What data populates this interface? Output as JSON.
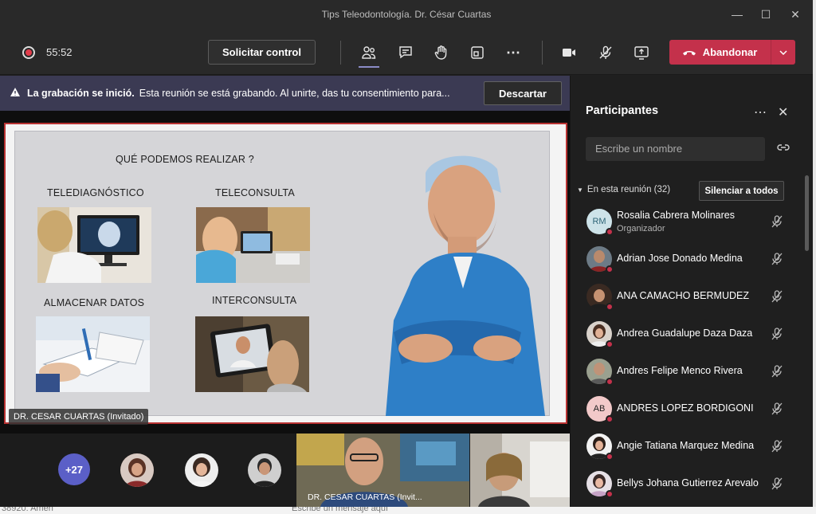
{
  "window": {
    "title": "Tips Teleodontología. Dr. César Cuartas"
  },
  "toolbar": {
    "timer": "55:52",
    "request_control_label": "Solicitar control",
    "leave_label": "Abandonar"
  },
  "banner": {
    "bold": "La grabación se inició.",
    "text": "Esta reunión se está grabando. Al unirte, das tu consentimiento para...",
    "dismiss_label": "Descartar"
  },
  "slide": {
    "heading": "QUÉ PODEMOS REALIZAR ?",
    "items": [
      "TELEDIAGNÓSTICO",
      "TELECONSULTA",
      "ALMACENAR DATOS",
      "INTERCONSULTA"
    ]
  },
  "presenter_tag": "DR. CESAR CUARTAS (Invitado)",
  "gallery": {
    "more_count": "+27",
    "video_tag": "DR. CESAR CUARTAS (Invit..."
  },
  "panel": {
    "title": "Participantes",
    "search_placeholder": "Escribe un nombre",
    "section_label": "En esta reunión (32)",
    "mute_all_label": "Silenciar a todos",
    "participants": [
      {
        "name": "Rosalia Cabrera Molinares",
        "role": "Organizador",
        "initials": "RM"
      },
      {
        "name": "Adrian Jose Donado Medina"
      },
      {
        "name": "ANA CAMACHO BERMUDEZ"
      },
      {
        "name": "Andrea Guadalupe Daza Daza"
      },
      {
        "name": "Andres Felipe Menco Rivera"
      },
      {
        "name": "ANDRES LOPEZ BORDIGONI",
        "initials": "AB"
      },
      {
        "name": "Angie Tatiana Marquez Medina"
      },
      {
        "name": "Bellys Johana Gutierrez Arevalo"
      }
    ]
  },
  "background": {
    "chat_line": "38920: Amen",
    "chat_placeholder": "Escribe un mensaje aquí"
  },
  "colors": {
    "leave": "#c4314b",
    "banner": "#3b3a53",
    "accent": "#5b5fc7",
    "presence_busy": "#c4314b"
  }
}
